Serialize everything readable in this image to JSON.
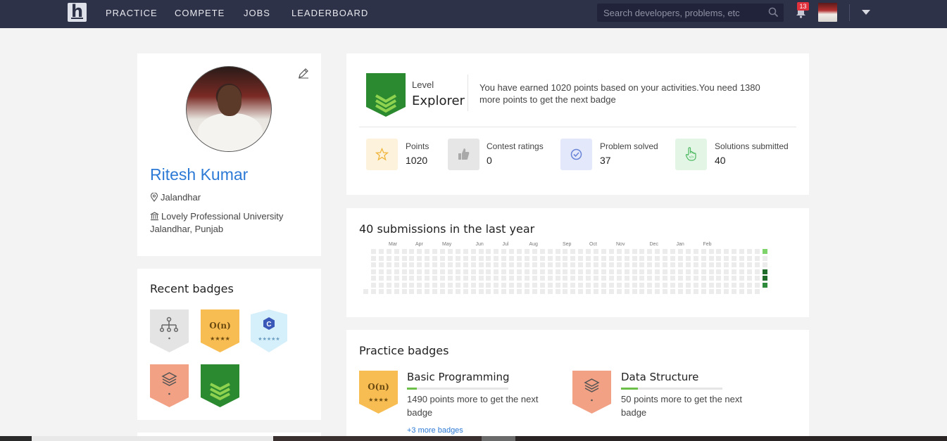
{
  "nav": {
    "logo": "h",
    "links": [
      "PRACTICE",
      "COMPETE",
      "JOBS",
      "LEADERBOARD"
    ],
    "search_placeholder": "Search developers, problems, etc",
    "notification_count": "13"
  },
  "profile": {
    "name": "Ritesh Kumar",
    "location": "Jalandhar",
    "university_line1": "Lovely Professional University",
    "university_line2": "Jalandhar, Punjab"
  },
  "recent_badges": {
    "title": "Recent badges",
    "items": [
      {
        "icon": "tree-icon",
        "color": "#e6e6e6"
      },
      {
        "icon": "complexity-icon",
        "color": "#f7bd4e",
        "text": "O(n)"
      },
      {
        "icon": "c-language-icon",
        "color": "#d9f0fb",
        "text": "C"
      },
      {
        "icon": "layers-icon",
        "color": "#f2a287"
      },
      {
        "icon": "chevrons-icon",
        "color": "#2e8b2e"
      }
    ]
  },
  "level": {
    "label": "Level",
    "name": "Explorer",
    "message": "You have earned 1020 points based on your activities.You need 1380 more points to get the next badge"
  },
  "stats": [
    {
      "label": "Points",
      "value": "1020",
      "icon": "star-icon",
      "color": "#fdf3dc"
    },
    {
      "label": "Contest ratings",
      "value": "0",
      "icon": "thumbs-up-icon",
      "color": "#e8e8e8"
    },
    {
      "label": "Problem solved",
      "value": "37",
      "icon": "check-circle-icon",
      "color": "#e3e8fa"
    },
    {
      "label": "Solutions submitted",
      "value": "40",
      "icon": "hand-code-icon",
      "color": "#e3f6e6"
    }
  ],
  "submissions": {
    "title": "40 submissions in the last year",
    "months": [
      "Mar",
      "Apr",
      "May",
      "Jun",
      "Jul",
      "Aug",
      "Sep",
      "Oct",
      "Nov",
      "Dec",
      "Jan",
      "Feb"
    ],
    "active_cells": [
      {
        "day": 0,
        "level": 1
      },
      {
        "day": 3,
        "level": 2
      },
      {
        "day": 4,
        "level": 2
      },
      {
        "day": 5,
        "level": 3
      }
    ]
  },
  "practice_badges": {
    "title": "Practice badges",
    "items": [
      {
        "name": "Basic Programming",
        "desc": "1490 points more to get the next badge",
        "progress": 0.1,
        "badge_text": "O(n)",
        "link": "+3 more badges"
      },
      {
        "name": "Data Structure",
        "desc": "50 points more to get the next badge",
        "progress": 0.17
      }
    ]
  }
}
